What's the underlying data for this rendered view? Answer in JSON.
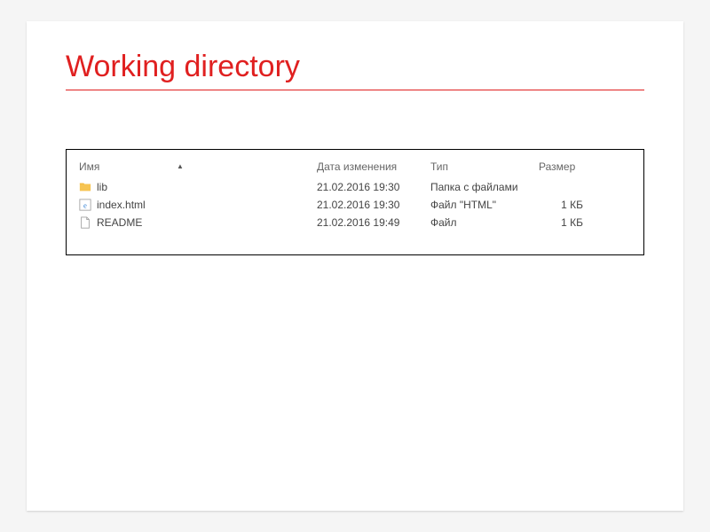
{
  "slide": {
    "title": "Working directory"
  },
  "explorer": {
    "columns": {
      "name": "Имя",
      "date": "Дата изменения",
      "type": "Тип",
      "size": "Размер"
    },
    "rows": [
      {
        "name": "lib",
        "date": "21.02.2016 19:30",
        "type": "Папка с файлами",
        "size": "",
        "icon": "folder-icon"
      },
      {
        "name": "index.html",
        "date": "21.02.2016 19:30",
        "type": "Файл \"HTML\"",
        "size": "1 КБ",
        "icon": "html-file-icon"
      },
      {
        "name": "README",
        "date": "21.02.2016 19:49",
        "type": "Файл",
        "size": "1 КБ",
        "icon": "file-icon"
      }
    ]
  }
}
